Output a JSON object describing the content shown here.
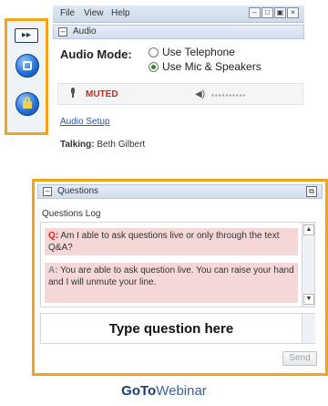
{
  "menu": {
    "file": "File",
    "view": "View",
    "help": "Help"
  },
  "window_controls": {
    "minimize": "–",
    "restore": "□",
    "maximize": "▣",
    "close": "×"
  },
  "left_toolbar": {
    "expand_label": "▸▸"
  },
  "audio": {
    "section_title": "Audio",
    "mode_label": "Audio Mode:",
    "option_telephone": "Use Telephone",
    "option_mic": "Use Mic & Speakers",
    "selected": "Use Mic & Speakers",
    "muted_label": "MUTED",
    "setup_link": "Audio Setup",
    "talking_label": "Talking:",
    "talking_name": "Beth Gilbert"
  },
  "questions": {
    "section_title": "Questions",
    "log_label": "Questions Log",
    "messages": [
      {
        "prefix": "Q:",
        "text": "Am I able to ask questions live or only through the text Q&A?"
      },
      {
        "prefix": "A:",
        "text": "You are able to ask question live. You can raise your hand and I will unmute your line."
      }
    ],
    "input_placeholder": "Type question here",
    "send_label": "Send"
  },
  "brand": {
    "strong": "GoTo",
    "light": "Webinar"
  }
}
